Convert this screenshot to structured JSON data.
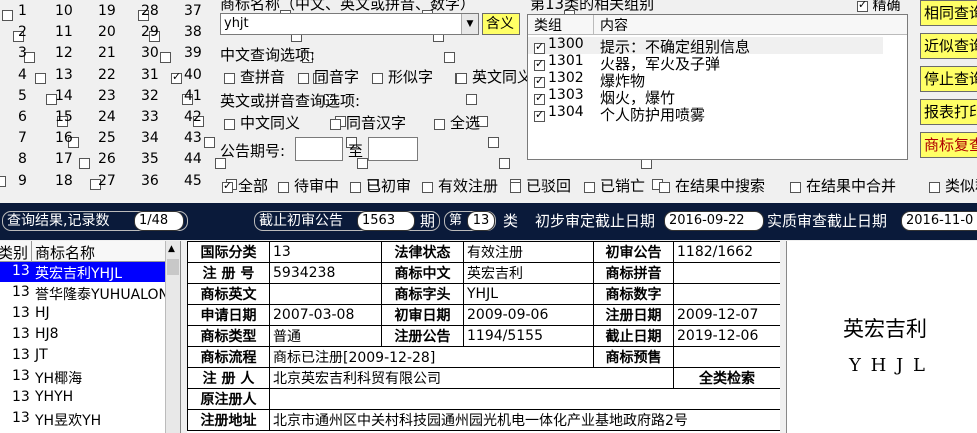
{
  "class_checks": {
    "cols": [
      [
        "1",
        "2",
        "3",
        "4",
        "5",
        "6",
        "7",
        "8",
        "9"
      ],
      [
        "10",
        "11",
        "12",
        "13",
        "14",
        "15",
        "16",
        "17",
        "18"
      ],
      [
        "19",
        "20",
        "21",
        "22",
        "23",
        "24",
        "25",
        "26",
        "27"
      ],
      [
        "28",
        "29",
        "30",
        "31",
        "32",
        "33",
        "34",
        "35",
        "36"
      ],
      [
        "37",
        "38",
        "39",
        "40",
        "41",
        "42",
        "43",
        "44",
        "45"
      ]
    ],
    "checked": [
      "13"
    ]
  },
  "query": {
    "name_label": "商标名称（中文、英文或拼音、数字）",
    "name_value": "yhjt",
    "contain_button": "含义",
    "cn_options_label": "中文查询选项:",
    "cn_options": [
      "查拼音",
      "同音字",
      "形似字",
      "英文同义"
    ],
    "en_options_label": "英文或拼音查询选项:",
    "en_options": [
      "中文同义",
      "同音汉字",
      "全选"
    ],
    "period_label": "公告期号:",
    "period_to": "至"
  },
  "groups": {
    "header": "第13类的相关组别",
    "precise_label": "精确",
    "col_group": "类组",
    "col_content": "内容",
    "rows": [
      {
        "code": "1300",
        "content": "提示：不确定组别信息"
      },
      {
        "code": "1301",
        "content": "火器，军火及子弹"
      },
      {
        "code": "1302",
        "content": "爆炸物"
      },
      {
        "code": "1303",
        "content": "烟火，爆竹"
      },
      {
        "code": "1304",
        "content": "个人防护用喷雾"
      }
    ]
  },
  "side_buttons": [
    "相同查询",
    "近似查询",
    "停止查询",
    "报表打印",
    "商标复查"
  ],
  "status_filters": [
    {
      "label": "全部",
      "checked": true
    },
    {
      "label": "待审中",
      "checked": false
    },
    {
      "label": "已初审",
      "checked": false
    },
    {
      "label": "有效注册",
      "checked": false
    },
    {
      "label": "已驳回",
      "checked": false
    },
    {
      "label": "已销亡",
      "checked": false
    },
    {
      "label": "在结果中搜索",
      "checked": false
    },
    {
      "label": "在结果中合并",
      "checked": false
    },
    {
      "label": "类似群",
      "checked": false
    }
  ],
  "info_bar": {
    "result_label": "查询结果,记录数",
    "result_value": "1/48",
    "cutoff_label": "截止初审公告",
    "cutoff_value": "1563",
    "period_unit": "期",
    "class_prefix": "第",
    "class_value": "13",
    "class_suffix": "类",
    "prelim_label": "初步审定截止日期",
    "prelim_value": "2016-09-22",
    "substantive_label": "实质审查截止日期",
    "substantive_value": "2016-11-0"
  },
  "results": {
    "col_class": "类别",
    "col_name": "商标名称",
    "rows": [
      {
        "class": "13",
        "name": "英宏吉利YHJL",
        "selected": true
      },
      {
        "class": "13",
        "name": "誉华隆泰YUHUALONG",
        "selected": false
      },
      {
        "class": "13",
        "name": "HJ",
        "selected": false
      },
      {
        "class": "13",
        "name": "HJ8",
        "selected": false
      },
      {
        "class": "13",
        "name": "JT",
        "selected": false
      },
      {
        "class": "13",
        "name": "YH椰海",
        "selected": false
      },
      {
        "class": "13",
        "name": "YHYH",
        "selected": false
      },
      {
        "class": "13",
        "name": "YH昱欢YH",
        "selected": false
      }
    ]
  },
  "detail": {
    "intl_class_label": "国际分类",
    "intl_class": "13",
    "legal_status_label": "法律状态",
    "legal_status": "有效注册",
    "prelim_notice_label": "初审公告",
    "prelim_notice": "1182/1662",
    "reg_no_label": "注 册 号",
    "reg_no": "5934238",
    "cn_name_label": "商标中文",
    "cn_name": "英宏吉利",
    "pinyin_label": "商标拼音",
    "pinyin": "",
    "en_name_label": "商标英文",
    "en_name": "",
    "initials_label": "商标字头",
    "initials": "YHJL",
    "digits_label": "商标数字",
    "digits": "",
    "apply_date_label": "申请日期",
    "apply_date": "2007-03-08",
    "prelim_date_label": "初审日期",
    "prelim_date": "2009-09-06",
    "reg_date_label": "注册日期",
    "reg_date": "2009-12-07",
    "type_label": "商标类型",
    "type": "普通",
    "reg_notice_label": "注册公告",
    "reg_notice": "1194/5155",
    "expiry_label": "截止日期",
    "expiry": "2019-12-06",
    "flow_label": "商标流程",
    "flow": "商标已注册[2009-12-28]",
    "warning_label": "商标预售",
    "warning": "",
    "registrant_label": "注 册 人",
    "registrant": "北京英宏吉利科贸有限公司",
    "all_class_search": "全类检索",
    "orig_registrant_label": "原注册人",
    "orig_registrant": "",
    "address_label": "注册地址",
    "address": "北京市通州区中关村科技园通州园光机电一体化产业基地政府路2号"
  },
  "preview": {
    "cn": "英宏吉利",
    "en": "Y H J L"
  },
  "colors": {
    "navy_bar": "#0a1a3a",
    "button_yellow": "#ffff66",
    "selected_row": "#0000ff"
  }
}
